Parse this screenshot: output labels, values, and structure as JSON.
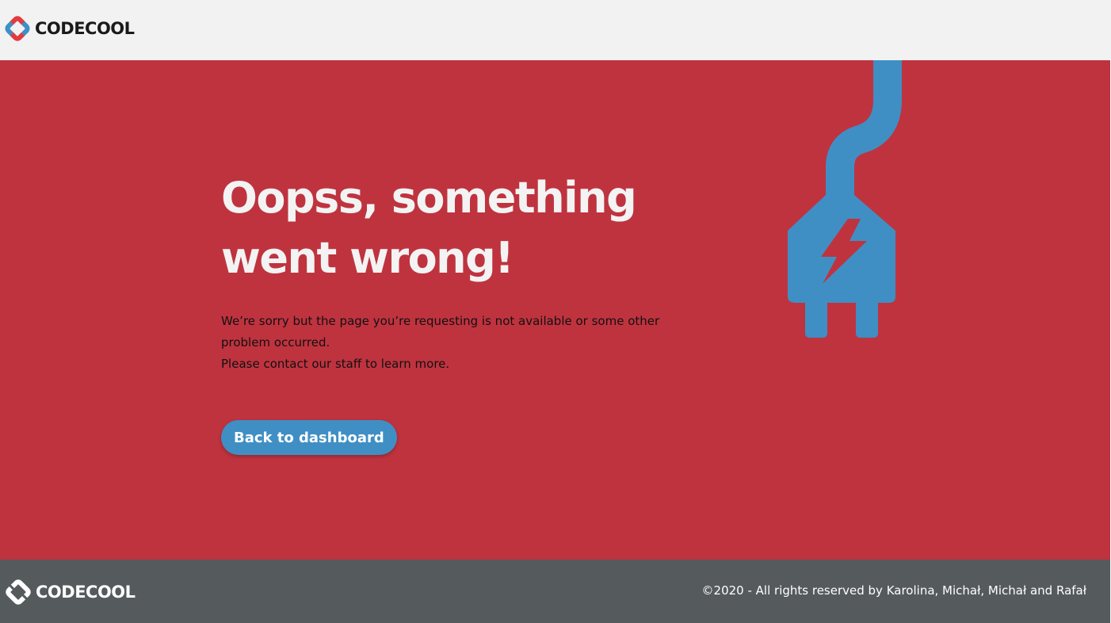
{
  "header": {
    "brand": "CODECOOL"
  },
  "error": {
    "title_line1": "Oopss, something",
    "title_line2": "went wrong!",
    "message_line1": "We’re sorry but the page you’re requesting is not available or some other problem occurred.",
    "message_line2": "Please contact our staff to learn more.",
    "button_label": "Back to dashboard"
  },
  "footer": {
    "brand": "CODECOOL",
    "copyright": "©2020 - All rights reserved by Karolina, Michał, Michał and Rafał"
  },
  "icons": {
    "logo": "codecool-logo-icon",
    "illustration": "unplugged-plug-icon"
  },
  "colors": {
    "header_bg": "#f2f2f2",
    "main_bg": "#bf333f",
    "accent_blue": "#3f8fc4",
    "footer_bg": "#555a5d",
    "title_text": "#f3f3f3"
  }
}
